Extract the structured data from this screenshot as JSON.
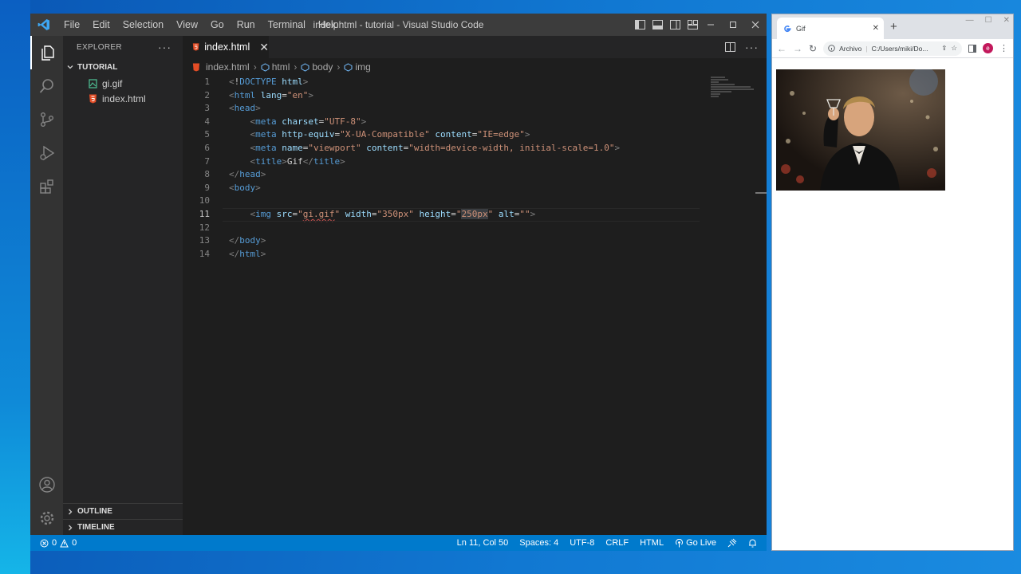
{
  "vscode": {
    "menu": [
      "File",
      "Edit",
      "Selection",
      "View",
      "Go",
      "Run",
      "Terminal",
      "Help"
    ],
    "window_title": "index.html - tutorial - Visual Studio Code",
    "explorer": {
      "title": "EXPLORER",
      "folder": "TUTORIAL",
      "files": [
        {
          "name": "gi.gif",
          "icon": "image-file-icon"
        },
        {
          "name": "index.html",
          "icon": "html-file-icon"
        }
      ],
      "outline": "OUTLINE",
      "timeline": "TIMELINE"
    },
    "tab": {
      "label": "index.html"
    },
    "breadcrumb": [
      "index.html",
      "html",
      "body",
      "img"
    ],
    "code_lines": [
      "<!DOCTYPE html>",
      "<html lang=\"en\">",
      "<head>",
      "    <meta charset=\"UTF-8\">",
      "    <meta http-equiv=\"X-UA-Compatible\" content=\"IE=edge\">",
      "    <meta name=\"viewport\" content=\"width=device-width, initial-scale=1.0\">",
      "    <title>Gif</title>",
      "</head>",
      "<body>",
      "",
      "    <img src=\"gi.gif\" width=\"350px\" height=\"250px\" alt=\"\">",
      "",
      "</body>",
      "</html>"
    ],
    "current_line": 11,
    "status": {
      "errors": "0",
      "warnings": "0",
      "position": "Ln 11, Col 50",
      "spaces": "Spaces: 4",
      "encoding": "UTF-8",
      "eol": "CRLF",
      "language": "HTML",
      "golive": "Go Live"
    },
    "colors": {
      "statusbar": "#007acc",
      "activitybar": "#333333",
      "sidebar": "#252526",
      "editor": "#1e1e1e"
    }
  },
  "browser": {
    "tab_title": "Gif",
    "address_scheme": "Archivo",
    "address_url": "C:/Users/miki/Do...",
    "avatar_letter": "e",
    "image_alt_desc": "animated gif"
  }
}
